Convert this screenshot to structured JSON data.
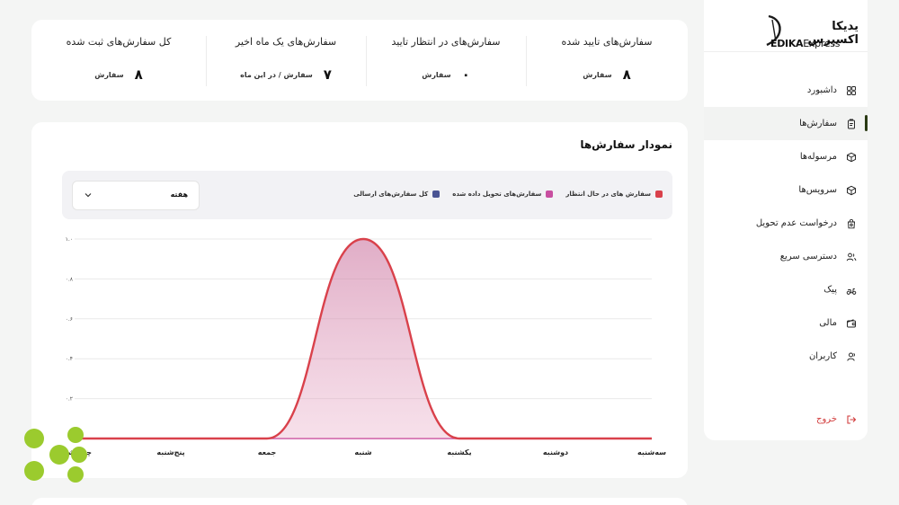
{
  "brand": {
    "name_fa": "یدیکا اکسپرس",
    "name_en_bold": "EDIKA",
    "name_en_light": "Express",
    "accent": "#2a3a14",
    "lime": "#9bcb2e"
  },
  "sidebar": {
    "items": [
      {
        "label": "داشبورد",
        "icon": "grid-icon",
        "active": false
      },
      {
        "label": "سفارش‌ها",
        "icon": "clipboard-icon",
        "active": true
      },
      {
        "label": "مرسوله‌ها",
        "icon": "box-icon",
        "active": false
      },
      {
        "label": "سرویس‌ها",
        "icon": "box-icon",
        "active": false
      },
      {
        "label": "درخواست عدم تحویل",
        "icon": "bag-icon",
        "active": false
      },
      {
        "label": "دسترسی سریع",
        "icon": "users-icon",
        "active": false
      },
      {
        "label": "پیک",
        "icon": "scooter-icon",
        "active": false
      },
      {
        "label": "مالی",
        "icon": "wallet-icon",
        "active": false
      },
      {
        "label": "کاربران",
        "icon": "user-icon",
        "active": false
      }
    ],
    "logout": {
      "label": "خروج",
      "icon": "logout-icon",
      "color": "#d23c3c"
    }
  },
  "stats": [
    {
      "title": "سفارش‌های تایید شده",
      "value": "۸",
      "unit": "سفارش"
    },
    {
      "title": "سفارش‌های در انتظار تایید",
      "value": "۰",
      "unit": "سفارش"
    },
    {
      "title": "سفارش‌های یک ماه اخیر",
      "value": "۷",
      "unit": "سفارش / در این ماه"
    },
    {
      "title": "کل سفارش‌های ثبت شده",
      "value": "۸",
      "unit": "سفارش"
    }
  ],
  "chart": {
    "title": "نمودار سفارش‌ها",
    "period_select": "هفته",
    "legend": [
      {
        "label": "سفارش های در حال انتظار",
        "color": "#d9414b"
      },
      {
        "label": "سفارش‌های تحویل داده شده",
        "color": "#c84fa0"
      },
      {
        "label": "کل سفارش‌های ارسالی",
        "color": "#4a5494"
      }
    ]
  },
  "chart_data": {
    "type": "area",
    "categories": [
      "سه‌شنبه",
      "دوشنبه",
      "یکشنبه",
      "شنبه",
      "جمعه",
      "پنج‌شنبه",
      "چهارشنبه"
    ],
    "y_tick_labels": [
      "۰.۲",
      "۰.۴",
      "۰.۶",
      "۰.۸",
      "۱.۰"
    ],
    "ylim": [
      0,
      1.0
    ],
    "series": [
      {
        "name": "سفارش های در حال انتظار",
        "values": [
          0,
          0,
          0,
          1,
          0,
          0,
          0
        ],
        "color": "#d9414b"
      },
      {
        "name": "سفارش‌های تحویل داده شده",
        "values": [
          0,
          0,
          0,
          0,
          0,
          0,
          0
        ],
        "color": "#c84fa0"
      }
    ],
    "grid": true,
    "legend_position": "top-right"
  }
}
